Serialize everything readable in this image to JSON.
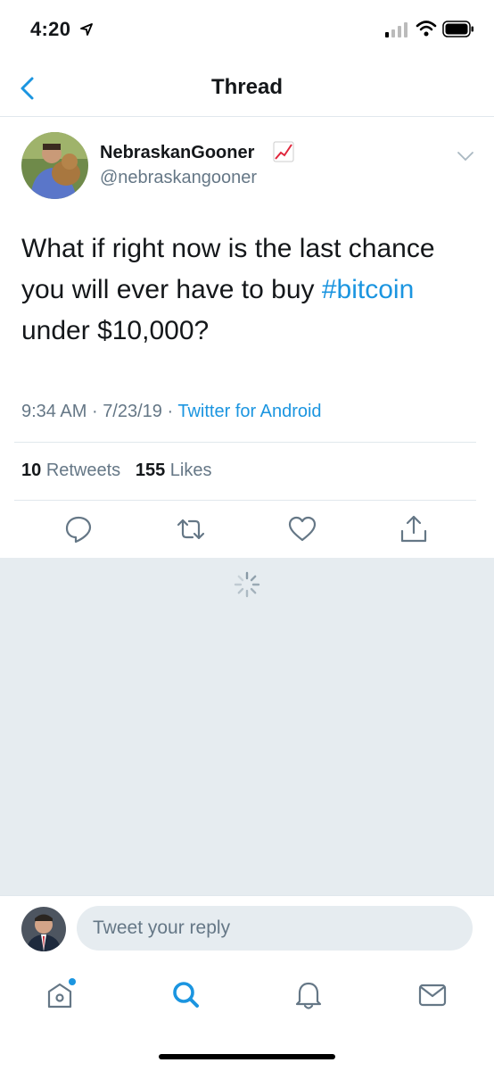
{
  "status_bar": {
    "time": "4:20"
  },
  "nav": {
    "title": "Thread"
  },
  "tweet": {
    "display_name": "NebraskanGooner",
    "handle": "@nebraskangooner",
    "text_before": "What if right now is the last chance you will ever have to buy ",
    "hashtag": "#bitcoin",
    "text_after": " under $10,000?",
    "time": "9:34 AM",
    "date": "7/23/19",
    "separator": "·",
    "client": "Twitter for Android",
    "retweet_count": "10",
    "retweet_label": "Retweets",
    "like_count": "155",
    "like_label": "Likes"
  },
  "reply": {
    "placeholder": "Tweet your reply"
  },
  "tabs": [
    {
      "icon": "home-icon",
      "notification_dot": true
    },
    {
      "icon": "search-icon",
      "active": true
    },
    {
      "icon": "bell-icon"
    },
    {
      "icon": "mail-icon"
    }
  ],
  "colors": {
    "accent": "#1b95e0",
    "muted": "#657786",
    "divider": "#e1e8ed",
    "loading_bg": "#e6ecf0"
  }
}
